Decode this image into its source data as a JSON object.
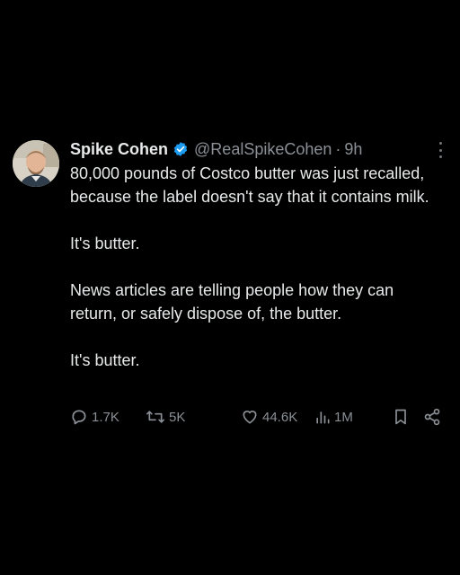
{
  "tweet": {
    "author_name": "Spike Cohen",
    "handle": "@RealSpikeCohen",
    "separator": "·",
    "time": "9h",
    "paragraphs": [
      "80,000 pounds of Costco butter was just recalled, because the label doesn't say that it contains milk.",
      "It's butter.",
      "News articles are telling people how they can return, or safely dispose of, the butter.",
      "It's butter."
    ],
    "stats": {
      "replies": "1.7K",
      "reposts": "5K",
      "likes": "44.6K",
      "views": "1M"
    }
  },
  "icons": {
    "verified": "verified-badge-icon",
    "more": "more-options-icon",
    "reply": "reply-icon",
    "repost": "repost-icon",
    "like": "heart-icon",
    "views": "views-chart-icon",
    "bookmark": "bookmark-icon",
    "share": "share-icon"
  },
  "colors": {
    "background": "#000000",
    "text": "#e7e9ea",
    "muted": "#8b9096",
    "verified": "#1d9bf0"
  }
}
